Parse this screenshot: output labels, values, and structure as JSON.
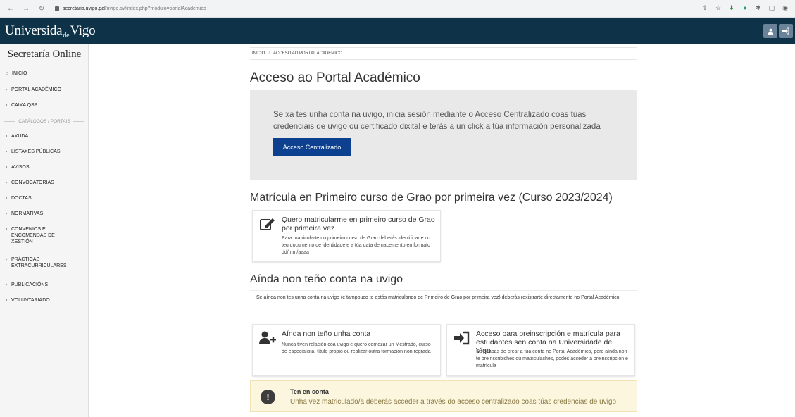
{
  "browser": {
    "url_domain": "secretaria.uvigo.gal",
    "url_path": "/uvigo.sv/index.php?modulo=portalAcademico"
  },
  "header": {
    "logo_left": "Universida",
    "logo_de": "de",
    "logo_right": "Vigo"
  },
  "sidebar": {
    "title": "Secretaría Online",
    "separator": "CATÁLOGOS / PORTAIS",
    "items": [
      {
        "label": "INICIO"
      },
      {
        "label": "PORTAL ACADÉMICO"
      },
      {
        "label": "CAIXA QSP"
      },
      {
        "label": "AXUDA"
      },
      {
        "label": "LISTAXES PÚBLICAS"
      },
      {
        "label": "AVISOS"
      },
      {
        "label": "CONVOCATORIAS"
      },
      {
        "label": "DOCTAS"
      },
      {
        "label": "NORMATIVAS"
      },
      {
        "label": "CONVENIOS E ENCOMENDAS DE XESTIÓN"
      },
      {
        "label": "PRÁCTICAS EXTRACURRICULARES"
      },
      {
        "label": "PUBLICACIÓNS"
      },
      {
        "label": "VOLUNTARIADO"
      }
    ]
  },
  "breadcrumb": {
    "home": "INICIO",
    "separator": "/",
    "current": "ACCESO AO PORTAL ACADÉMICO"
  },
  "main": {
    "title": "Acceso ao Portal Académico",
    "login_text": "Se xa tes unha conta na uvigo, inicia sesión mediante o Acceso Centralizado coas túas credenciais de uvigo ou certificado dixital e terás a un click a túa información personalizada",
    "login_button": "Acceso Centralizado",
    "section1_title": "Matrícula en Primeiro curso de Grao por primeira vez (Curso 2023/2024)",
    "card1_title": "Quero matricularme en primeiro curso de Grao por primeira vez",
    "card1_desc": "Para matricularte no primeiro curso de Grao deberás identificarte co teu documento de identidade e a túa data de nacemento en formato dd/mm/aaaa",
    "section2_title": "Aínda non teño conta na uvigo",
    "section2_notice": "Se aínda non tes unha conta na uvigo (e tampouco te estás matriculando de Primeiro de Grao por primeira vez) deberás rexistrarte directamente no Portal Académico",
    "card2_title": "Aínda non teño unha conta",
    "card2_desc": "Nunca tiven relación coa uvigo e quero comezar un Mestrado, curso de especialista, título propio ou realizar outra formación non regrada",
    "card3_title": "Acceso para preinscripción e matrícula para estudantes sen conta na Universidade de Vigo",
    "card3_desc": "Se acabas de crear a túa conta no Portal Académico, pero aínda non te preinscribiches ou matriculaches, podes acceder a preinscripción e matrícula",
    "warning_title": "Ten en conta",
    "warning_text": "Unha vez matriculado/a deberás acceder a través do acceso centralizado coas túas credencias de uvigo"
  }
}
